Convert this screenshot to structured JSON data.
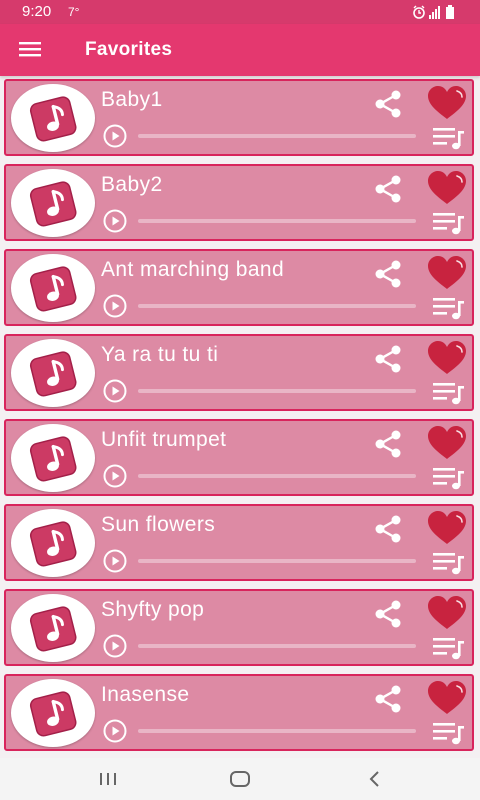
{
  "status_bar": {
    "time": "9:20",
    "extra": "7°"
  },
  "app_bar": {
    "title": "Favorites",
    "menu_icon": "hamburger-menu-icon"
  },
  "colors": {
    "status_bar": "#d63a6c",
    "app_bar": "#e4386f",
    "card_bg": "#dd8aa4",
    "card_border": "#d8245c",
    "heart": "#c8233f",
    "thumb_icon": "#cc3a64"
  },
  "songs": [
    {
      "title": "Baby1",
      "progress": 0
    },
    {
      "title": "Baby2",
      "progress": 0
    },
    {
      "title": "Ant marching band",
      "progress": 0
    },
    {
      "title": "Ya ra tu tu ti",
      "progress": 0
    },
    {
      "title": "Unfit trumpet",
      "progress": 0
    },
    {
      "title": "Sun flowers",
      "progress": 0
    },
    {
      "title": "Shyfty pop",
      "progress": 0
    },
    {
      "title": "Inasense",
      "progress": 0
    }
  ],
  "item_icons": {
    "thumb": "music-note-icon",
    "play": "play-icon",
    "share": "share-icon",
    "favorite": "heart-icon",
    "queue": "playlist-icon"
  },
  "nav_bar": {
    "buttons": [
      "recent-apps-icon",
      "home-icon",
      "back-icon"
    ]
  }
}
